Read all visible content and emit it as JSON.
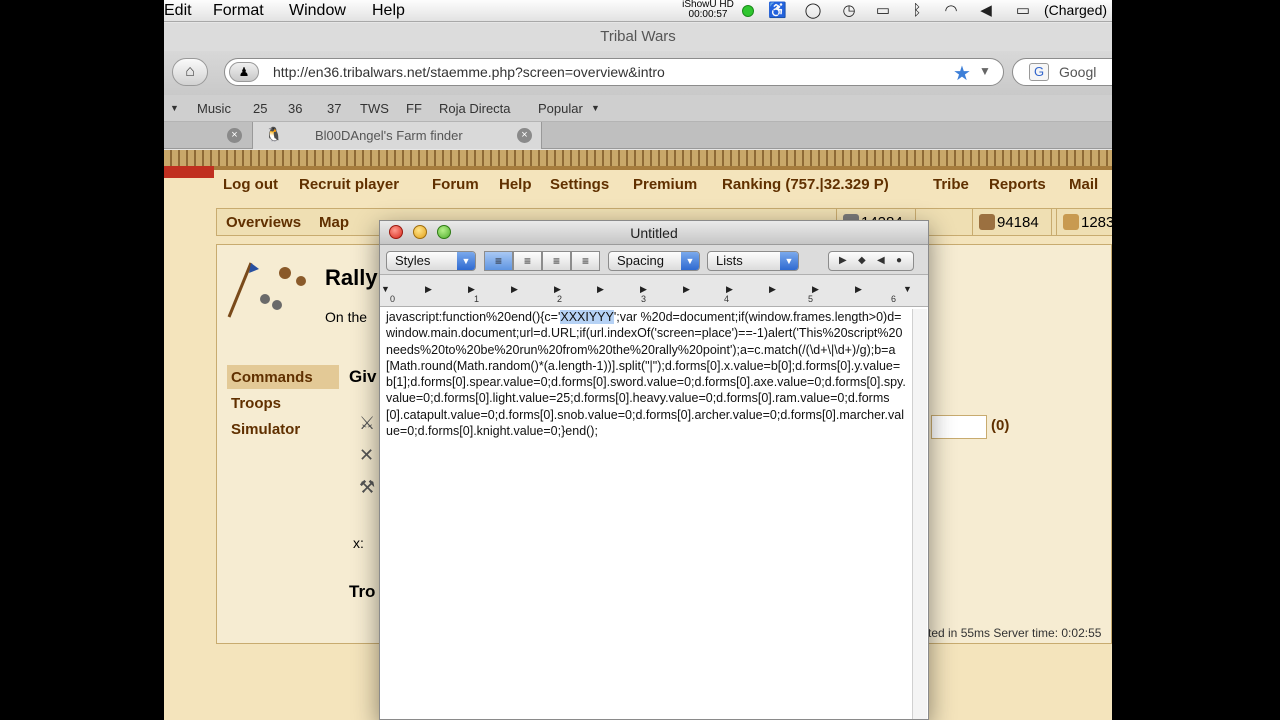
{
  "menubar": {
    "items": [
      "Edit",
      "Format",
      "Window",
      "Help"
    ],
    "ishow_label": "iShowU HD",
    "ishow_time": "00:00:57",
    "battery": "(Charged)"
  },
  "browser": {
    "window_title": "Tribal Wars",
    "url": "http://en36.tribalwars.net/staemme.php?screen=overview&intro",
    "search_placeholder": "Googl",
    "bookmarks": [
      "Music",
      "25",
      "36",
      "37",
      "TWS",
      "FF",
      "Roja Directa",
      "Popular"
    ],
    "tab_label": "Bl00DAngel's Farm finder"
  },
  "game": {
    "topmenu": [
      "Log out",
      "Recruit player",
      "Forum",
      "Help",
      "Settings",
      "Premium",
      "Ranking (757.|32.329 P)",
      "Tribe",
      "Reports",
      "Mail"
    ],
    "subbar": [
      "Overviews",
      "Map"
    ],
    "resources": [
      "14284",
      "94184",
      "1283"
    ],
    "page_title": "Rally",
    "page_subtitle": "On the",
    "side_menu": [
      "Commands",
      "Troops",
      "Simulator"
    ],
    "give_header": "Giv",
    "x_label": "x:",
    "troops_header": "Tro",
    "count": "(0)",
    "footer": "ted in 55ms Server time: 0:02:55"
  },
  "textedit": {
    "title": "Untitled",
    "styles_label": "Styles",
    "spacing_label": "Spacing",
    "lists_label": "Lists",
    "ruler_numbers": [
      "0",
      "1",
      "2",
      "3",
      "4",
      "5",
      "6"
    ],
    "text_before": "javascript:function%20end(){c='",
    "text_selected": "XXXIYYY",
    "text_after": "';var %20d=document;if(window.frames.length>0)d=window.main.document;url=d.URL;if(url.indexOf('screen=place')==-1)alert('This%20script%20needs%20to%20be%20run%20from%20the%20rally%20point');a=c.match(/(\\d+\\|\\d+)/g);b=a[Math.round(Math.random()*(a.length-1))].split(\"|\");d.forms[0].x.value=b[0];d.forms[0].y.value=b[1];d.forms[0].spear.value=0;d.forms[0].sword.value=0;d.forms[0].axe.value=0;d.forms[0].spy.value=0;d.forms[0].light.value=25;d.forms[0].heavy.value=0;d.forms[0].ram.value=0;d.forms[0].catapult.value=0;d.forms[0].snob.value=0;d.forms[0].archer.value=0;d.forms[0].marcher.value=0;d.forms[0].knight.value=0;}end();"
  }
}
